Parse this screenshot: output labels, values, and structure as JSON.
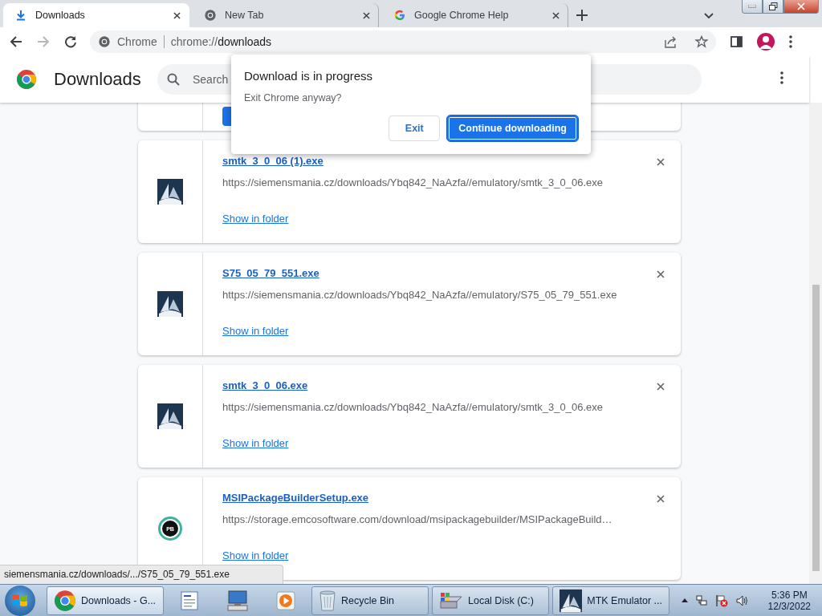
{
  "tabs": [
    {
      "title": "Downloads",
      "kind": "download",
      "selected": true
    },
    {
      "title": "New Tab",
      "kind": "chrome",
      "selected": false
    },
    {
      "title": "Google Chrome Help",
      "kind": "google",
      "selected": false
    }
  ],
  "toolbar": {
    "site_label": "Chrome",
    "url_prefix": "chrome://",
    "url_path": "downloads"
  },
  "page": {
    "title": "Downloads",
    "search": {
      "placeholder": "Search"
    }
  },
  "downloads": [
    {
      "name": "smtk_3_0_06 (1).exe",
      "url": "https://siemensmania.cz/downloads/Ybq842_NaAzfa//emulatory/smtk_3_0_06.exe",
      "action": "Show in folder",
      "kind": "siemens"
    },
    {
      "name": "S75_05_79_551.exe",
      "url": "https://siemensmania.cz/downloads/Ybq842_NaAzfa//emulatory/S75_05_79_551.exe",
      "action": "Show in folder",
      "kind": "siemens"
    },
    {
      "name": "smtk_3_0_06.exe",
      "url": "https://siemensmania.cz/downloads/Ybq842_NaAzfa//emulatory/smtk_3_0_06.exe",
      "action": "Show in folder",
      "kind": "siemens"
    },
    {
      "name": "MSIPackageBuilderSetup.exe",
      "url": "https://storage.emcosoftware.com/download/msipackagebuilder/MSIPackageBuild…",
      "action": "Show in folder",
      "kind": "badge",
      "icon_text": "PB"
    }
  ],
  "dialog": {
    "title": "Download is in progress",
    "message": "Exit Chrome anyway?",
    "buttons": [
      {
        "label": "Exit",
        "kind": "secondary"
      },
      {
        "label": "Continue downloading",
        "kind": "primary"
      }
    ]
  },
  "status_bubble": "siemensmania.cz/downloads/.../S75_05_79_551.exe",
  "taskbar": {
    "items": [
      {
        "kind": "chrome",
        "label": "Downloads - G...",
        "selected": true
      },
      {
        "kind": "wordpad",
        "selected": false
      },
      {
        "kind": "computer",
        "selected": false
      },
      {
        "kind": "media",
        "selected": false
      },
      {
        "kind": "recycle",
        "label": "Recycle Bin",
        "selected": false
      },
      {
        "kind": "disk",
        "label": "Local Disk (C:)",
        "selected": false
      },
      {
        "kind": "siemens",
        "label": "MTK Emulator ...",
        "selected": false
      }
    ],
    "time": "5:36 PM",
    "date": "12/3/2022"
  }
}
